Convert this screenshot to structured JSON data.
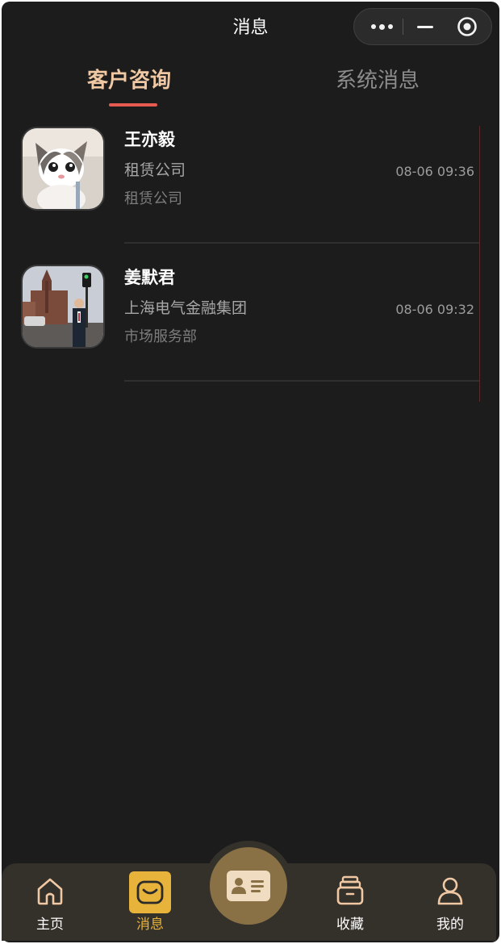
{
  "header": {
    "title": "消息"
  },
  "capsule": {
    "more_icon": "more-dots-icon",
    "minimize_icon": "minimize-icon",
    "close_icon": "target-close-icon"
  },
  "tabs": [
    {
      "label": "客户咨询",
      "active": true
    },
    {
      "label": "系统消息",
      "active": false
    }
  ],
  "messages": [
    {
      "name": "王亦毅",
      "company": "租赁公司",
      "department": "租赁公司",
      "time": "08-06 09:36",
      "avatar": "cat-photo"
    },
    {
      "name": "姜默君",
      "company": "上海电气金融集团",
      "department": "市场服务部",
      "time": "08-06 09:32",
      "avatar": "street-photo"
    }
  ],
  "tabbar": {
    "items": [
      {
        "label": "主页",
        "icon": "home-icon",
        "active": false
      },
      {
        "label": "消息",
        "icon": "message-icon",
        "active": true
      },
      {
        "label": "",
        "icon": "id-card-icon",
        "active": false
      },
      {
        "label": "收藏",
        "icon": "archive-box-icon",
        "active": false
      },
      {
        "label": "我的",
        "icon": "user-icon",
        "active": false
      }
    ]
  },
  "colors": {
    "background": "#1c1c1c",
    "accent": "#f0c9a4",
    "underline": "#e65a50",
    "tab_active": "#e8b33a",
    "tabbar": "#34302a"
  }
}
